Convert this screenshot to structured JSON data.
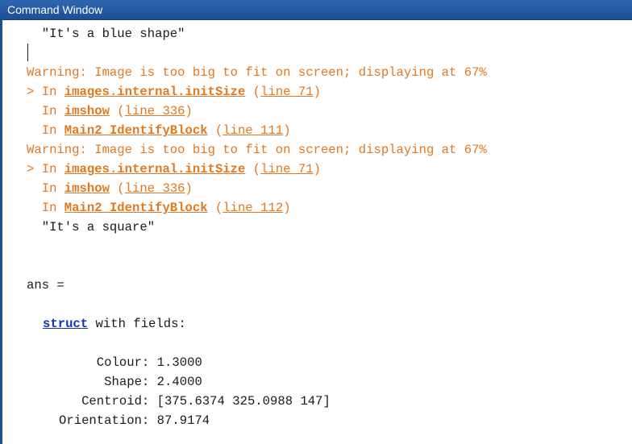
{
  "window": {
    "title": "Command Window"
  },
  "output": {
    "line_blue_shape": "  \"It's a blue shape\"",
    "warning1": {
      "message": "Warning: Image is too big to fit on screen; displaying at 67%",
      "trace": [
        {
          "prefix": "> In ",
          "function": "images.internal.initSize",
          "line_text": "line 71"
        },
        {
          "prefix": "  In ",
          "function": "imshow",
          "line_text": "line 336"
        },
        {
          "prefix": "  In ",
          "function": "Main2_IdentifyBlock",
          "line_text": "line 111"
        }
      ]
    },
    "warning2": {
      "message": "Warning: Image is too big to fit on screen; displaying at 67%",
      "trace": [
        {
          "prefix": "> In ",
          "function": "images.internal.initSize",
          "line_text": "line 71"
        },
        {
          "prefix": "  In ",
          "function": "imshow",
          "line_text": "line 336"
        },
        {
          "prefix": "  In ",
          "function": "Main2_IdentifyBlock",
          "line_text": "line 112"
        }
      ]
    },
    "line_square": "  \"It's a square\"",
    "ans_label": "ans =",
    "struct_word": "struct",
    "struct_rest": " with fields:",
    "fields": [
      {
        "label": "     Colour: ",
        "value": "1.3000"
      },
      {
        "label": "      Shape: ",
        "value": "2.4000"
      },
      {
        "label": "   Centroid: ",
        "value": "[375.6374 325.0988 147]"
      },
      {
        "label": "Orientation: ",
        "value": "87.9174"
      }
    ]
  },
  "colors": {
    "warning": "#e2781f",
    "struct_link": "#1233b5",
    "titlebar": "#2f66b0"
  }
}
